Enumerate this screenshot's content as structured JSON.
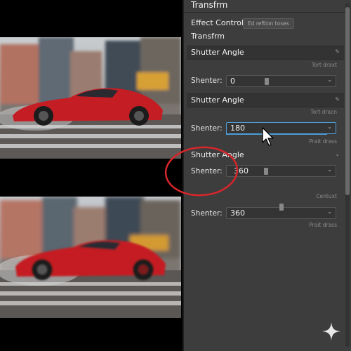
{
  "panel": {
    "title": "Transfrm",
    "effect_controls_label": "Effect Controls",
    "tab_pill": "Ed reftion toses",
    "subtitle": "Transfrm"
  },
  "sections": [
    {
      "header": "Shutter Angle",
      "minor_text": "Tort draxt",
      "prop_label": "Shenter:",
      "value": "0",
      "focused": false
    },
    {
      "header": "Shutter Angle",
      "minor_text": "Tort dracn",
      "prop_label": "Shenter:",
      "value": "180",
      "focused": true,
      "below_text": "Prait drass"
    },
    {
      "header": "Shutter Angle",
      "prop_label": "Shenter:",
      "value": "360",
      "focused": false
    },
    {
      "minor_text": "Centuxt",
      "prop_label": "Shenter:",
      "value": "360",
      "below_text": "Prait drass"
    }
  ],
  "icons": {
    "header_edit": "pencil-icon",
    "dropdown": "chevron-down-icon",
    "cursor": "mouse-pointer-icon",
    "corner": "sparkle-icon"
  },
  "colors": {
    "panel_bg": "#3d3d3d",
    "focus_accent": "#4e9cd6",
    "annotation": "#d8262a",
    "car": "#c41e24"
  }
}
